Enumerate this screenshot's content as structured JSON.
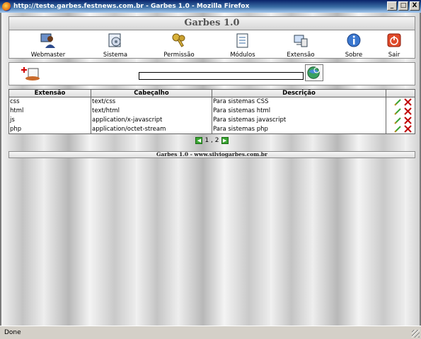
{
  "window": {
    "title": "http://teste.garbes.festnews.com.br - Garbes 1.0 - Mozilla Firefox",
    "controls": {
      "minimize": "_",
      "maximize": "□",
      "close": "X"
    }
  },
  "app": {
    "title": "Garbes 1.0",
    "menu": [
      {
        "label": "Webmaster",
        "icon": "webmaster-icon"
      },
      {
        "label": "Sistema",
        "icon": "system-icon"
      },
      {
        "label": "Permissão",
        "icon": "keys-icon"
      },
      {
        "label": "Módulos",
        "icon": "modules-icon"
      },
      {
        "label": "Extensão",
        "icon": "extension-icon"
      },
      {
        "label": "Sobre",
        "icon": "info-icon"
      },
      {
        "label": "Sair",
        "icon": "power-icon"
      }
    ],
    "search": {
      "value": "",
      "placeholder": ""
    },
    "table": {
      "headers": [
        "Extensão",
        "Cabeçalho",
        "Descrição",
        ""
      ],
      "rows": [
        {
          "ext": "css",
          "header": "text/css",
          "desc": "Para sistemas CSS"
        },
        {
          "ext": "html",
          "header": "text/html",
          "desc": "Para sistemas html"
        },
        {
          "ext": "js",
          "header": "application/x-javascript",
          "desc": "Para sistemas javascript"
        },
        {
          "ext": "php",
          "header": "application/octet-stream",
          "desc": "Para sistemas php"
        }
      ]
    },
    "pager": {
      "text": "1 , 2"
    },
    "footer": "Garbes 1.0 - www.silviogarbes.com.br"
  },
  "status": {
    "text": "Done"
  },
  "colors": {
    "accent": "#0a246a",
    "edit": "#3aa532",
    "delete": "#c00000"
  }
}
